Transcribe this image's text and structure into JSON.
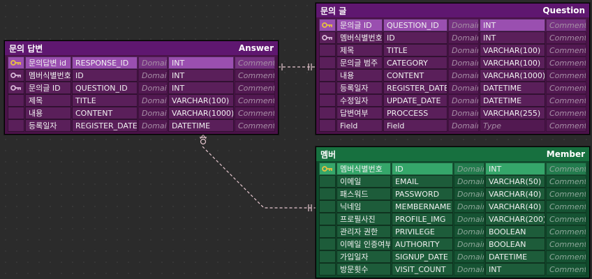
{
  "answer": {
    "title_kr": "문의 답변",
    "title_en": "Answer",
    "rows": [
      {
        "key": "pk",
        "kr": "문의답변 id",
        "col": "RESPONSE_ID",
        "domain": "Domain",
        "type": "INT",
        "comment": "Comment"
      },
      {
        "key": "fk",
        "kr": "멤버식별번호",
        "col": "ID",
        "domain": "Domain",
        "type": "INT",
        "comment": "Comment"
      },
      {
        "key": "fk",
        "kr": "문의글 ID",
        "col": "QUESTION_ID",
        "domain": "Domain",
        "type": "INT",
        "comment": "Comment"
      },
      {
        "key": "",
        "kr": "제목",
        "col": "TITLE",
        "domain": "Domain",
        "type": "VARCHAR(100)",
        "comment": "Comment"
      },
      {
        "key": "",
        "kr": "내용",
        "col": "CONTENT",
        "domain": "Domain",
        "type": "VARCHAR(1000)",
        "comment": "Comment"
      },
      {
        "key": "",
        "kr": "등록일자",
        "col": "REGISTER_DATE",
        "domain": "Domain",
        "type": "DATETIME",
        "comment": "Comment"
      }
    ]
  },
  "question": {
    "title_kr": "문의 글",
    "title_en": "Question",
    "rows": [
      {
        "key": "pk",
        "kr": "문의글 ID",
        "col": "QUESTION_ID",
        "domain": "Domain",
        "type": "INT",
        "comment": "Comment"
      },
      {
        "key": "fk",
        "kr": "멤버식별번호",
        "col": "ID",
        "domain": "Domain",
        "type": "INT",
        "comment": "Comment"
      },
      {
        "key": "",
        "kr": "제목",
        "col": "TITLE",
        "domain": "Domain",
        "type": "VARCHAR(100)",
        "comment": "Comment"
      },
      {
        "key": "",
        "kr": "문의글 범주",
        "col": "CATEGORY",
        "domain": "Domain",
        "type": "VARCHAR(100)",
        "comment": "Comment"
      },
      {
        "key": "",
        "kr": "내용",
        "col": "CONTENT",
        "domain": "Domain",
        "type": "VARCHAR(1000)",
        "comment": "Comment"
      },
      {
        "key": "",
        "kr": "등록일자",
        "col": "REGISTER_DATE",
        "domain": "Domain",
        "type": "DATETIME",
        "comment": "Comment"
      },
      {
        "key": "",
        "kr": "수정일자",
        "col": "UPDATE_DATE",
        "domain": "Domain",
        "type": "DATETIME",
        "comment": "Comment"
      },
      {
        "key": "",
        "kr": "답변여부",
        "col": "PROCCESS",
        "domain": "Domain",
        "type": "VARCHAR(255)",
        "comment": "Comment"
      },
      {
        "key": "",
        "kr": "Field",
        "col": "Field",
        "domain": "Domain",
        "type": "Type",
        "comment": "Comment"
      }
    ]
  },
  "member": {
    "title_kr": "멤버",
    "title_en": "Member",
    "rows": [
      {
        "key": "pk",
        "kr": "멤버식별번호",
        "col": "ID",
        "domain": "Domain",
        "type": "INT",
        "comment": "Comment"
      },
      {
        "key": "",
        "kr": "이메일",
        "col": "EMAIL",
        "domain": "Domain",
        "type": "VARCHAR(50)",
        "comment": "Comment"
      },
      {
        "key": "",
        "kr": "패스워드",
        "col": "PASSWORD",
        "domain": "Domain",
        "type": "VARCHAR(40)",
        "comment": "Comment"
      },
      {
        "key": "",
        "kr": "닉네임",
        "col": "MEMBERNAME",
        "domain": "Domain",
        "type": "VARCHAR(40)",
        "comment": "Comment"
      },
      {
        "key": "",
        "kr": "프로필사진",
        "col": "PROFILE_IMG",
        "domain": "Domain",
        "type": "VARCHAR(200)",
        "comment": "Comment"
      },
      {
        "key": "",
        "kr": "관리자 권한",
        "col": "PRIVILEGE",
        "domain": "Domain",
        "type": "BOOLEAN",
        "comment": "Comment"
      },
      {
        "key": "",
        "kr": "이메일 인증여부",
        "col": "AUTHORITY",
        "domain": "Domain",
        "type": "BOOLEAN",
        "comment": "Comment"
      },
      {
        "key": "",
        "kr": "가입일자",
        "col": "SIGNUP_DATE",
        "domain": "Domain",
        "type": "DATETIME",
        "comment": "Comment"
      },
      {
        "key": "",
        "kr": "방문횟수",
        "col": "VISIT_COUNT",
        "domain": "Domain",
        "type": "INT",
        "comment": "Comment"
      }
    ]
  },
  "colors": {
    "pk_key": "#e8c040",
    "fk_key": "#d8b8d8",
    "relation_line": "#e8c8d0"
  },
  "icons": {
    "pk": "key-icon",
    "fk": "foreign-key-icon"
  }
}
